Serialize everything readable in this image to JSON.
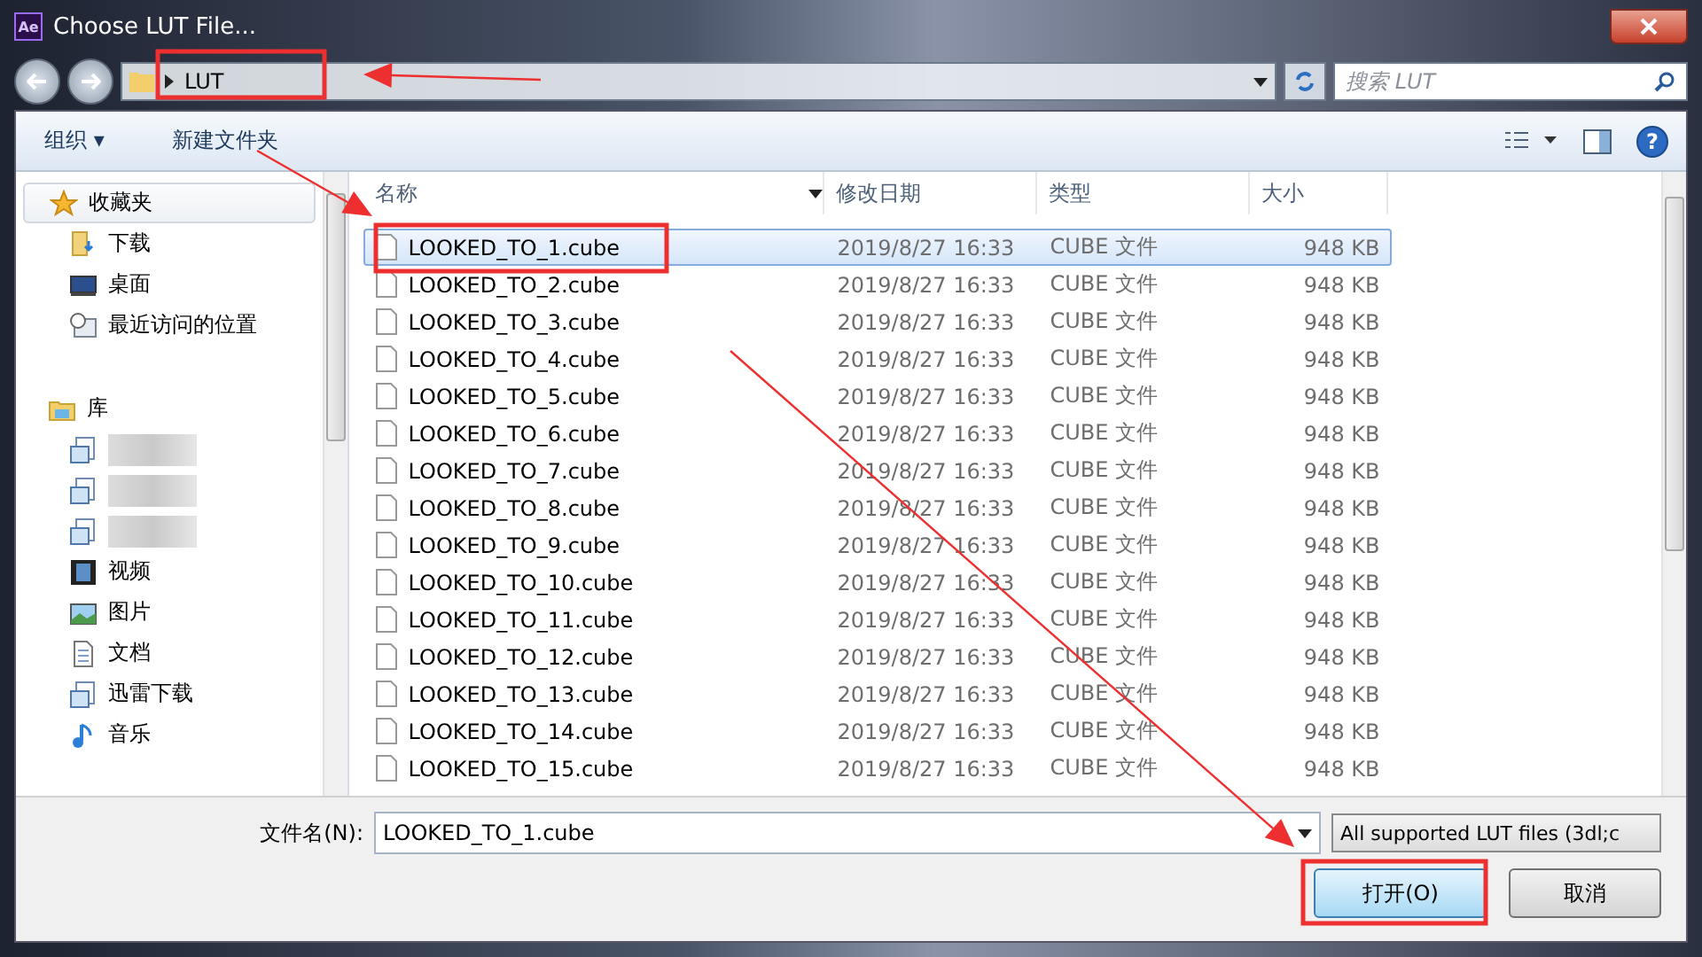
{
  "window": {
    "title": "Choose LUT File...",
    "app_logo": "Ae"
  },
  "address": {
    "path": "LUT",
    "search_placeholder": "搜索 LUT"
  },
  "toolbar": {
    "organize": "组织 ▾",
    "new_folder": "新建文件夹",
    "help": "?"
  },
  "sidebar": {
    "items": [
      {
        "label": "收藏夹",
        "kind": "group",
        "children": [
          {
            "label": "下载",
            "kind": "download"
          },
          {
            "label": "桌面",
            "kind": "desktop"
          },
          {
            "label": "最近访问的位置",
            "kind": "recent"
          }
        ]
      },
      {
        "label": "库",
        "kind": "library",
        "children": [
          {
            "kind": "blurred"
          },
          {
            "kind": "blurred"
          },
          {
            "kind": "blurred"
          },
          {
            "label": "视频",
            "kind": "video"
          },
          {
            "label": "图片",
            "kind": "picture"
          },
          {
            "label": "文档",
            "kind": "document"
          },
          {
            "label": "迅雷下载",
            "kind": "lib"
          },
          {
            "label": "音乐",
            "kind": "music"
          }
        ]
      }
    ]
  },
  "table": {
    "columns": [
      "名称",
      "修改日期",
      "类型",
      "大小"
    ],
    "rows": [
      {
        "name": "LOOKED_TO_1.cube",
        "date": "2019/8/27 16:33",
        "type": "CUBE 文件",
        "size": "948 KB",
        "selected": true
      },
      {
        "name": "LOOKED_TO_2.cube",
        "date": "2019/8/27 16:33",
        "type": "CUBE 文件",
        "size": "948 KB",
        "selected": false
      },
      {
        "name": "LOOKED_TO_3.cube",
        "date": "2019/8/27 16:33",
        "type": "CUBE 文件",
        "size": "948 KB",
        "selected": false
      },
      {
        "name": "LOOKED_TO_4.cube",
        "date": "2019/8/27 16:33",
        "type": "CUBE 文件",
        "size": "948 KB",
        "selected": false
      },
      {
        "name": "LOOKED_TO_5.cube",
        "date": "2019/8/27 16:33",
        "type": "CUBE 文件",
        "size": "948 KB",
        "selected": false
      },
      {
        "name": "LOOKED_TO_6.cube",
        "date": "2019/8/27 16:33",
        "type": "CUBE 文件",
        "size": "948 KB",
        "selected": false
      },
      {
        "name": "LOOKED_TO_7.cube",
        "date": "2019/8/27 16:33",
        "type": "CUBE 文件",
        "size": "948 KB",
        "selected": false
      },
      {
        "name": "LOOKED_TO_8.cube",
        "date": "2019/8/27 16:33",
        "type": "CUBE 文件",
        "size": "948 KB",
        "selected": false
      },
      {
        "name": "LOOKED_TO_9.cube",
        "date": "2019/8/27 16:33",
        "type": "CUBE 文件",
        "size": "948 KB",
        "selected": false
      },
      {
        "name": "LOOKED_TO_10.cube",
        "date": "2019/8/27 16:33",
        "type": "CUBE 文件",
        "size": "948 KB",
        "selected": false
      },
      {
        "name": "LOOKED_TO_11.cube",
        "date": "2019/8/27 16:33",
        "type": "CUBE 文件",
        "size": "948 KB",
        "selected": false
      },
      {
        "name": "LOOKED_TO_12.cube",
        "date": "2019/8/27 16:33",
        "type": "CUBE 文件",
        "size": "948 KB",
        "selected": false
      },
      {
        "name": "LOOKED_TO_13.cube",
        "date": "2019/8/27 16:33",
        "type": "CUBE 文件",
        "size": "948 KB",
        "selected": false
      },
      {
        "name": "LOOKED_TO_14.cube",
        "date": "2019/8/27 16:33",
        "type": "CUBE 文件",
        "size": "948 KB",
        "selected": false
      },
      {
        "name": "LOOKED_TO_15.cube",
        "date": "2019/8/27 16:33",
        "type": "CUBE 文件",
        "size": "948 KB",
        "selected": false
      }
    ]
  },
  "footer": {
    "filename_label": "文件名(N):",
    "filename": "LOOKED_TO_1.cube",
    "filter": "All supported LUT files (3dl;c",
    "open": "打开(O)",
    "cancel": "取消"
  }
}
